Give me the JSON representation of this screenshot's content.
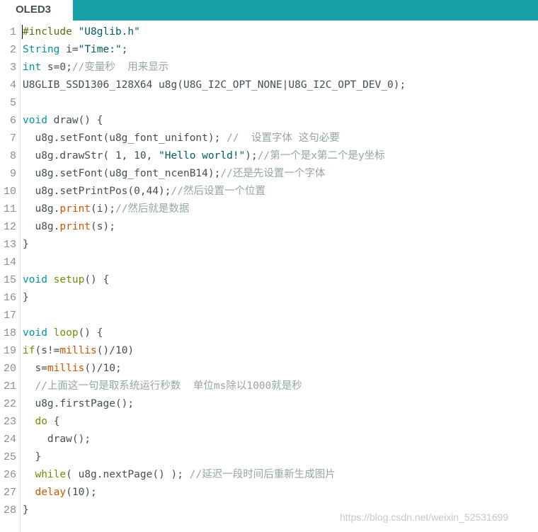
{
  "tab": {
    "label": "OLED3"
  },
  "editor": {
    "lines": [
      {
        "n": "1",
        "tokens": [
          {
            "t": "#include",
            "c": "kw-pre"
          },
          {
            "t": " \"U8glib.h\"",
            "c": "str"
          }
        ]
      },
      {
        "n": "2",
        "tokens": [
          {
            "t": "String",
            "c": "kw-type"
          },
          {
            "t": " i=",
            "c": ""
          },
          {
            "t": "\"Time:\"",
            "c": "str"
          },
          {
            "t": ";",
            "c": ""
          }
        ]
      },
      {
        "n": "3",
        "tokens": [
          {
            "t": "int",
            "c": "kw-type"
          },
          {
            "t": " s=0;",
            "c": ""
          },
          {
            "t": "//变量秒  用来显示",
            "c": "cmt"
          }
        ]
      },
      {
        "n": "4",
        "tokens": [
          {
            "t": "U8GLIB_SSD1306_128X64 u8g(U8G_I2C_OPT_NONE|U8G_I2C_OPT_DEV_0);",
            "c": ""
          }
        ]
      },
      {
        "n": "5",
        "tokens": []
      },
      {
        "n": "6",
        "tokens": [
          {
            "t": "void",
            "c": "kw-type"
          },
          {
            "t": " draw() {",
            "c": ""
          }
        ]
      },
      {
        "n": "7",
        "tokens": [
          {
            "t": "  u8g.setFont(u8g_font_unifont); ",
            "c": ""
          },
          {
            "t": "//  设置字体 这句必要",
            "c": "cmt"
          }
        ]
      },
      {
        "n": "8",
        "tokens": [
          {
            "t": "  u8g.drawStr( 1, 10, ",
            "c": ""
          },
          {
            "t": "\"Hello world!\"",
            "c": "str"
          },
          {
            "t": ");",
            "c": ""
          },
          {
            "t": "//第一个是x第二个是y坐标",
            "c": "cmt"
          }
        ]
      },
      {
        "n": "9",
        "tokens": [
          {
            "t": "  u8g.setFont(u8g_font_ncenB14);",
            "c": ""
          },
          {
            "t": "//还是先设置一个字体",
            "c": "cmt"
          }
        ]
      },
      {
        "n": "10",
        "tokens": [
          {
            "t": "  u8g.setPrintPos(0,44);",
            "c": ""
          },
          {
            "t": "//然后设置一个位置",
            "c": "cmt"
          }
        ]
      },
      {
        "n": "11",
        "tokens": [
          {
            "t": "  u8g.",
            "c": ""
          },
          {
            "t": "print",
            "c": "kw-fn"
          },
          {
            "t": "(i);",
            "c": ""
          },
          {
            "t": "//然后就是数据",
            "c": "cmt"
          }
        ]
      },
      {
        "n": "12",
        "tokens": [
          {
            "t": "  u8g.",
            "c": ""
          },
          {
            "t": "print",
            "c": "kw-fn"
          },
          {
            "t": "(s);",
            "c": ""
          }
        ]
      },
      {
        "n": "13",
        "tokens": [
          {
            "t": "}",
            "c": ""
          }
        ]
      },
      {
        "n": "14",
        "tokens": []
      },
      {
        "n": "15",
        "tokens": [
          {
            "t": "void",
            "c": "kw-type"
          },
          {
            "t": " ",
            "c": ""
          },
          {
            "t": "setup",
            "c": "kw-ctrl"
          },
          {
            "t": "() {",
            "c": ""
          }
        ]
      },
      {
        "n": "16",
        "tokens": [
          {
            "t": "}",
            "c": ""
          }
        ]
      },
      {
        "n": "17",
        "tokens": []
      },
      {
        "n": "18",
        "tokens": [
          {
            "t": "void",
            "c": "kw-type"
          },
          {
            "t": " ",
            "c": ""
          },
          {
            "t": "loop",
            "c": "kw-ctrl"
          },
          {
            "t": "() {",
            "c": ""
          }
        ]
      },
      {
        "n": "19",
        "tokens": [
          {
            "t": "if",
            "c": "kw-ctrl"
          },
          {
            "t": "(s!=",
            "c": ""
          },
          {
            "t": "millis",
            "c": "kw-fn"
          },
          {
            "t": "()/10)",
            "c": ""
          }
        ]
      },
      {
        "n": "20",
        "tokens": [
          {
            "t": "  s=",
            "c": ""
          },
          {
            "t": "millis",
            "c": "kw-fn"
          },
          {
            "t": "()/10;",
            "c": ""
          }
        ]
      },
      {
        "n": "21",
        "tokens": [
          {
            "t": "  //上面这一句是取系统运行秒数  单位ms除以1000就是秒",
            "c": "cmt"
          }
        ]
      },
      {
        "n": "22",
        "tokens": [
          {
            "t": "  u8g.firstPage();",
            "c": ""
          }
        ]
      },
      {
        "n": "23",
        "tokens": [
          {
            "t": "  ",
            "c": ""
          },
          {
            "t": "do",
            "c": "kw-ctrl"
          },
          {
            "t": " {",
            "c": ""
          }
        ]
      },
      {
        "n": "24",
        "tokens": [
          {
            "t": "    draw();",
            "c": ""
          }
        ]
      },
      {
        "n": "25",
        "tokens": [
          {
            "t": "  }",
            "c": ""
          }
        ]
      },
      {
        "n": "26",
        "tokens": [
          {
            "t": "  ",
            "c": ""
          },
          {
            "t": "while",
            "c": "kw-ctrl"
          },
          {
            "t": "( u8g.nextPage() ); ",
            "c": ""
          },
          {
            "t": "//延迟一段时间后重新生成图片",
            "c": "cmt"
          }
        ]
      },
      {
        "n": "27",
        "tokens": [
          {
            "t": "  ",
            "c": ""
          },
          {
            "t": "delay",
            "c": "kw-fn"
          },
          {
            "t": "(10);",
            "c": ""
          }
        ]
      },
      {
        "n": "28",
        "tokens": [
          {
            "t": "}",
            "c": ""
          }
        ]
      }
    ]
  },
  "watermark": {
    "text": "https://blog.csdn.net/weixin_52531699"
  },
  "colors": {
    "tab_bar": "#17a1a5",
    "type_keyword": "#00979c",
    "control_keyword": "#728e00",
    "function": "#d35400",
    "string": "#005c5f",
    "comment": "#95a5a6",
    "text": "#434f54"
  }
}
